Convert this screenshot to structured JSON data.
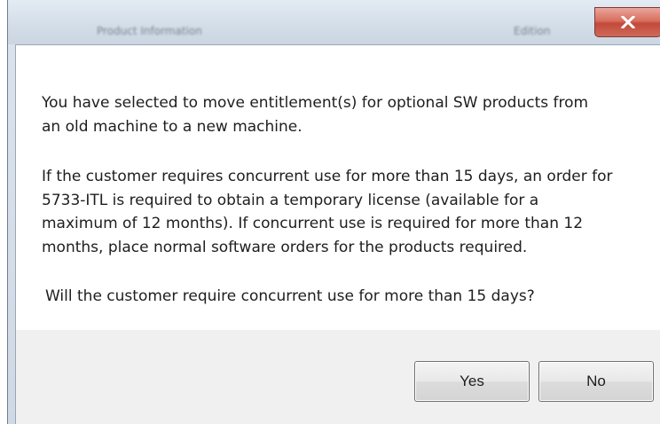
{
  "window": {
    "title": "Product Information",
    "title_extra": "Edition"
  },
  "message": {
    "paragraph1": [
      "You have selected to move entitlement(s) for optional SW products from",
      "an old machine to a new machine."
    ],
    "paragraph2": [
      "If the customer requires concurrent use for more than 15 days, an order for",
      "5733-ITL is required to obtain a temporary license (available for a",
      "maximum of 12 months). If concurrent use is required for more than 12",
      "months, place normal software orders for the products required."
    ],
    "question": "Will the customer require concurrent use for more than 15 days?"
  },
  "buttons": {
    "yes": "Yes",
    "no": "No"
  },
  "icons": {
    "close": "close-icon"
  },
  "colors": {
    "close_button": "#c24a3a",
    "titlebar": "#d3dde8"
  }
}
